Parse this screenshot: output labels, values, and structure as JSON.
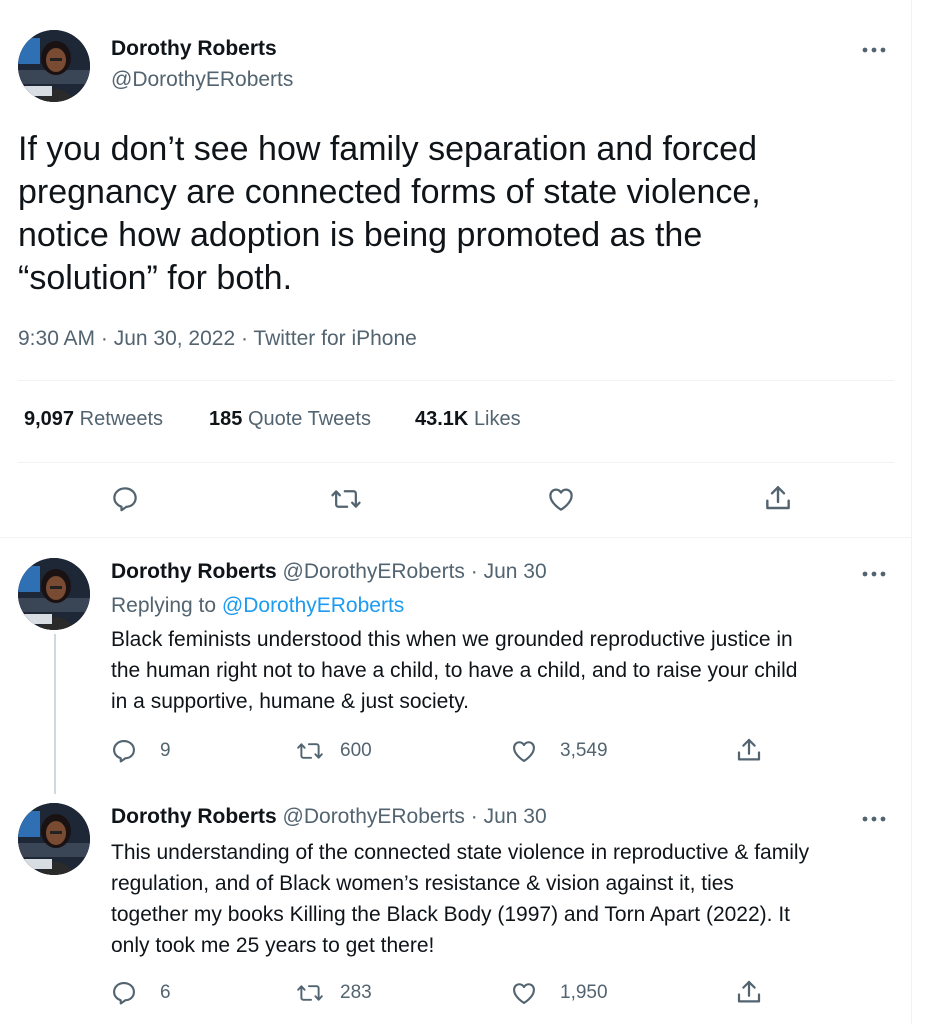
{
  "main_tweet": {
    "author_name": "Dorothy Roberts",
    "handle": "@DorothyERoberts",
    "text_lines": [
      "If you don’t see how family separation and forced",
      "pregnancy are connected forms of state violence,",
      "notice how adoption is being promoted as the",
      "“solution” for both."
    ],
    "timestamp": "9:30 AM · Jun 30, 2022 · Twitter for iPhone",
    "stats": {
      "retweets_count": "9,097",
      "retweets_label": "Retweets",
      "quotes_count": "185",
      "quotes_label": "Quote Tweets",
      "likes_count": "43.1K",
      "likes_label": "Likes"
    },
    "actions": [
      "reply-icon",
      "retweet-icon",
      "like-icon",
      "share-icon"
    ]
  },
  "replies": [
    {
      "author_name": "Dorothy Roberts",
      "handle_date": "@DorothyERoberts · Jun 30",
      "replying_label": "Replying to",
      "replying_to": "@DorothyERoberts",
      "text_lines": [
        "Black feminists understood this when we grounded reproductive justice in",
        "the human right not to have a child, to have a child, and to raise your child",
        "in a supportive, humane & just society."
      ],
      "reply_count": "9",
      "retweet_count": "600",
      "like_count": "3,549"
    },
    {
      "author_name": "Dorothy Roberts",
      "handle_date": "@DorothyERoberts · Jun 30",
      "text_lines": [
        "This understanding of the connected state violence in reproductive & family",
        "regulation, and of Black women’s resistance & vision against it, ties",
        "together my books Killing the Black Body (1997) and Torn Apart (2022). It",
        "only took me 25 years to get there!"
      ],
      "reply_count": "6",
      "retweet_count": "283",
      "like_count": "1,950"
    }
  ],
  "colors": {
    "text": "#0f1419",
    "secondary": "#536471",
    "link": "#1d9bf0",
    "divider": "#eff3f4"
  }
}
